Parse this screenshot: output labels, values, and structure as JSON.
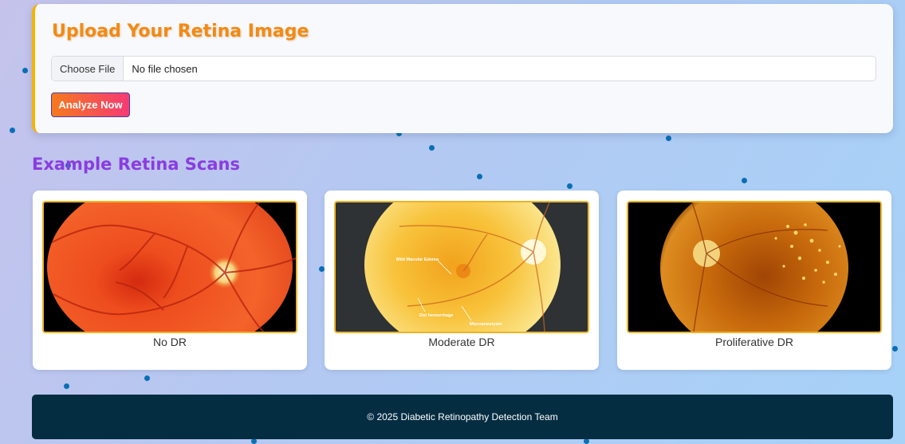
{
  "upload": {
    "title": "Upload Your Retina Image",
    "choose_file_label": "Choose File",
    "file_status": "No file chosen",
    "analyze_label": "Analyze Now"
  },
  "examples": {
    "title": "Example Retina Scans",
    "items": [
      {
        "caption": "No DR"
      },
      {
        "caption": "Moderate DR",
        "annotations": [
          "Mild Macular Edema",
          "Dot hemorrhage",
          "Microaneurysm"
        ]
      },
      {
        "caption": "Proliferative DR"
      }
    ]
  },
  "footer": {
    "text": "© 2025 Diabetic Retinopathy Detection Team"
  },
  "colors": {
    "title_orange": "#f28a13",
    "section_purple": "#8a3de0",
    "card_border": "#f5b400",
    "footer_bg": "#042d42",
    "button_gradient": [
      "#f7791e",
      "#f53a73"
    ]
  }
}
